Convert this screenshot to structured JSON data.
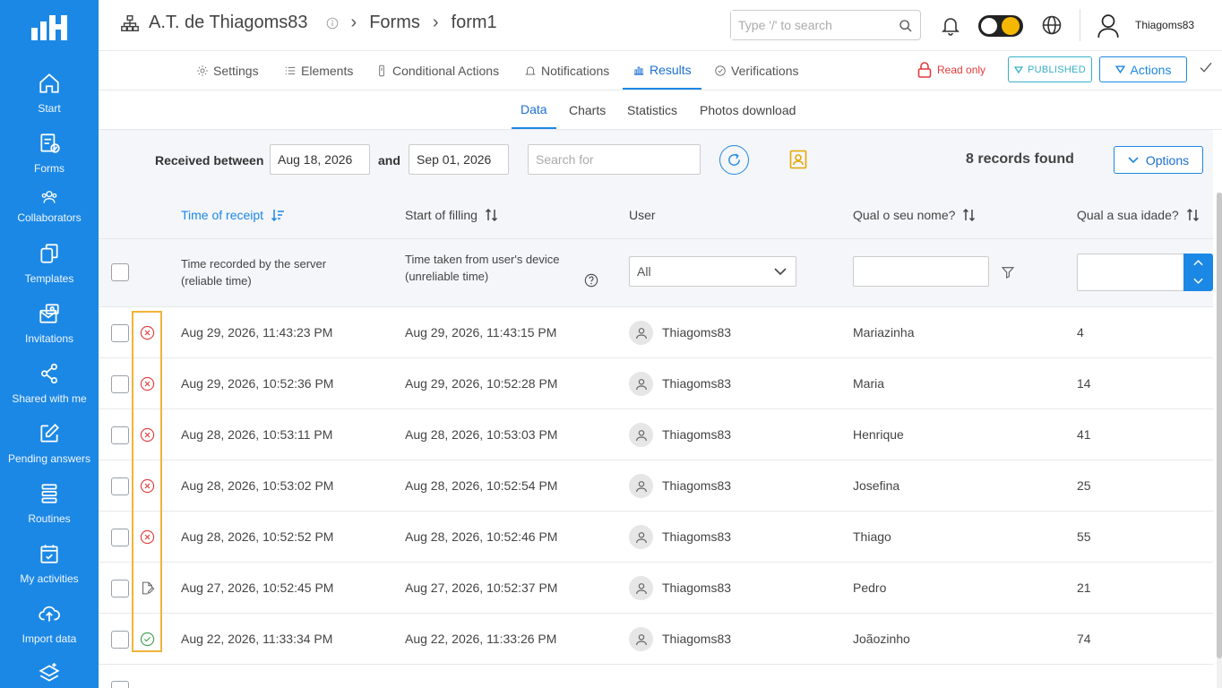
{
  "header": {
    "title": "A.T. de Thiagoms83",
    "crumb_forms": "Forms",
    "crumb_form": "form1",
    "search_placeholder": "Type '/' to search",
    "user_name": "Thiagoms83"
  },
  "sidebar": {
    "items": [
      {
        "label": "Start",
        "icon": "home-icon"
      },
      {
        "label": "Forms",
        "icon": "forms-icon"
      },
      {
        "label": "Collaborators",
        "icon": "users-icon"
      },
      {
        "label": "Templates",
        "icon": "templates-icon"
      },
      {
        "label": "Invitations",
        "icon": "invitations-icon"
      },
      {
        "label": "Shared with me",
        "icon": "share-icon"
      },
      {
        "label": "Pending answers",
        "icon": "edit-icon"
      },
      {
        "label": "Routines",
        "icon": "routines-icon"
      },
      {
        "label": "My activities",
        "icon": "calendar-icon"
      },
      {
        "label": "Import data",
        "icon": "cloud-upload-icon"
      }
    ]
  },
  "tabs": {
    "settings": "Settings",
    "elements": "Elements",
    "conditional": "Conditional Actions",
    "notifications": "Notifications",
    "results": "Results",
    "verifications": "Verifications",
    "read_only": "Read only",
    "published": "PUBLISHED",
    "actions": "Actions"
  },
  "subtabs": {
    "data": "Data",
    "charts": "Charts",
    "statistics": "Statistics",
    "photos": "Photos download"
  },
  "filters": {
    "received_between": "Received between",
    "date_from": "Aug 18, 2026",
    "and": "and",
    "date_to": "Sep 01, 2026",
    "search_placeholder": "Search for",
    "records_found": "8 records found",
    "options": "Options"
  },
  "table": {
    "columns": {
      "time_receipt": "Time of receipt",
      "start_filling": "Start of filling",
      "user": "User",
      "name": "Qual o seu nome?",
      "age": "Qual a sua idade?"
    },
    "notes": {
      "receipt_line1": "Time recorded by the server",
      "receipt_line2": "(reliable time)",
      "filling_line1": "Time taken from user's device",
      "filling_line2": "(unreliable time)"
    },
    "user_filter": "All",
    "rows": [
      {
        "status": "error",
        "receipt": "Aug 29, 2026, 11:43:23 PM",
        "start": "Aug 29, 2026, 11:43:15 PM",
        "user": "Thiagoms83",
        "name": "Mariazinha",
        "age": "4"
      },
      {
        "status": "error",
        "receipt": "Aug 29, 2026, 10:52:36 PM",
        "start": "Aug 29, 2026, 10:52:28 PM",
        "user": "Thiagoms83",
        "name": "Maria",
        "age": "14"
      },
      {
        "status": "error",
        "receipt": "Aug 28, 2026, 10:53:11 PM",
        "start": "Aug 28, 2026, 10:53:03 PM",
        "user": "Thiagoms83",
        "name": "Henrique",
        "age": "41"
      },
      {
        "status": "error",
        "receipt": "Aug 28, 2026, 10:53:02 PM",
        "start": "Aug 28, 2026, 10:52:54 PM",
        "user": "Thiagoms83",
        "name": "Josefina",
        "age": "25"
      },
      {
        "status": "error",
        "receipt": "Aug 28, 2026, 10:52:52 PM",
        "start": "Aug 28, 2026, 10:52:46 PM",
        "user": "Thiagoms83",
        "name": "Thiago",
        "age": "55"
      },
      {
        "status": "draft",
        "receipt": "Aug 27, 2026, 10:52:45 PM",
        "start": "Aug 27, 2026, 10:52:37 PM",
        "user": "Thiagoms83",
        "name": "Pedro",
        "age": "21"
      },
      {
        "status": "ok",
        "receipt": "Aug 22, 2026, 11:33:34 PM",
        "start": "Aug 22, 2026, 11:33:26 PM",
        "user": "Thiagoms83",
        "name": "Joãozinho",
        "age": "74"
      }
    ]
  },
  "colors": {
    "brand": "#1c88e5",
    "error": "#e23b3b",
    "ok": "#3aa04a",
    "highlight": "#f0b43a"
  }
}
